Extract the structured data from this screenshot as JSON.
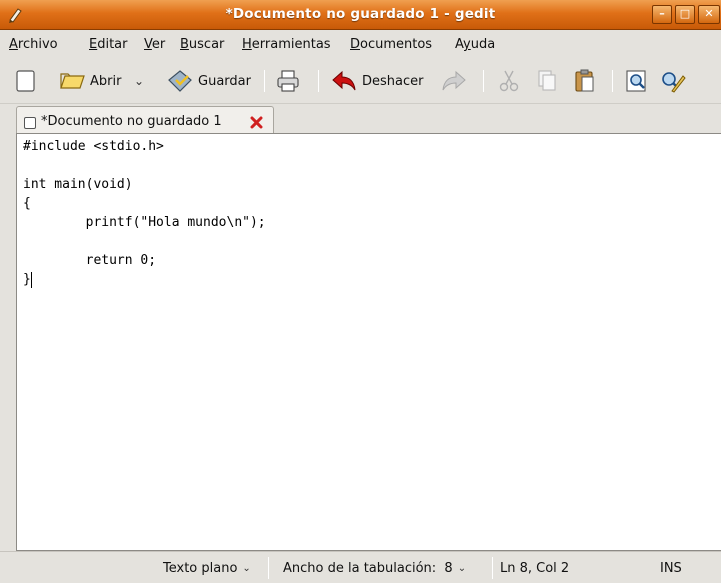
{
  "window": {
    "title": "*Documento no guardado 1 - gedit",
    "controls": [
      "minimize",
      "maximize",
      "close"
    ]
  },
  "menubar": {
    "items": [
      {
        "label": "Archivo",
        "mnemonic": "A"
      },
      {
        "label": "Editar",
        "mnemonic": "E"
      },
      {
        "label": "Ver",
        "mnemonic": "V"
      },
      {
        "label": "Buscar",
        "mnemonic": "B"
      },
      {
        "label": "Herramientas",
        "mnemonic": "H"
      },
      {
        "label": "Documentos",
        "mnemonic": "D"
      },
      {
        "label": "Ayuda",
        "mnemonic": "y"
      }
    ]
  },
  "toolbar": {
    "new_icon": "new-document-icon",
    "open_label": "Abrir",
    "open_icon": "folder-open-icon",
    "save_label": "Guardar",
    "save_icon": "save-disk-icon",
    "print_icon": "printer-icon",
    "undo_label": "Deshacer",
    "undo_icon": "undo-arrow-icon",
    "redo_icon": "redo-arrow-icon",
    "cut_icon": "scissors-icon",
    "copy_icon": "copy-icon",
    "paste_icon": "clipboard-paste-icon",
    "find_icon": "magnifier-icon",
    "replace_icon": "find-replace-icon"
  },
  "tabs": [
    {
      "label": "*Documento no guardado 1",
      "active": true
    }
  ],
  "editor": {
    "lines": [
      "#include <stdio.h>",
      "",
      "int main(void)",
      "{",
      "        printf(\"Hola mundo\\n\");",
      "",
      "        return 0;",
      "}"
    ],
    "cursor": {
      "line": 8,
      "col": 2
    }
  },
  "statusbar": {
    "syntax": "Texto plano",
    "tab_width": "Ancho de la tabulación:  8",
    "position": "Ln 8, Col 2",
    "mode": "INS"
  },
  "colors": {
    "titlebar_accent": "#e07018",
    "close_tab": "#d02020",
    "undo_arrow": "#cc1111"
  }
}
